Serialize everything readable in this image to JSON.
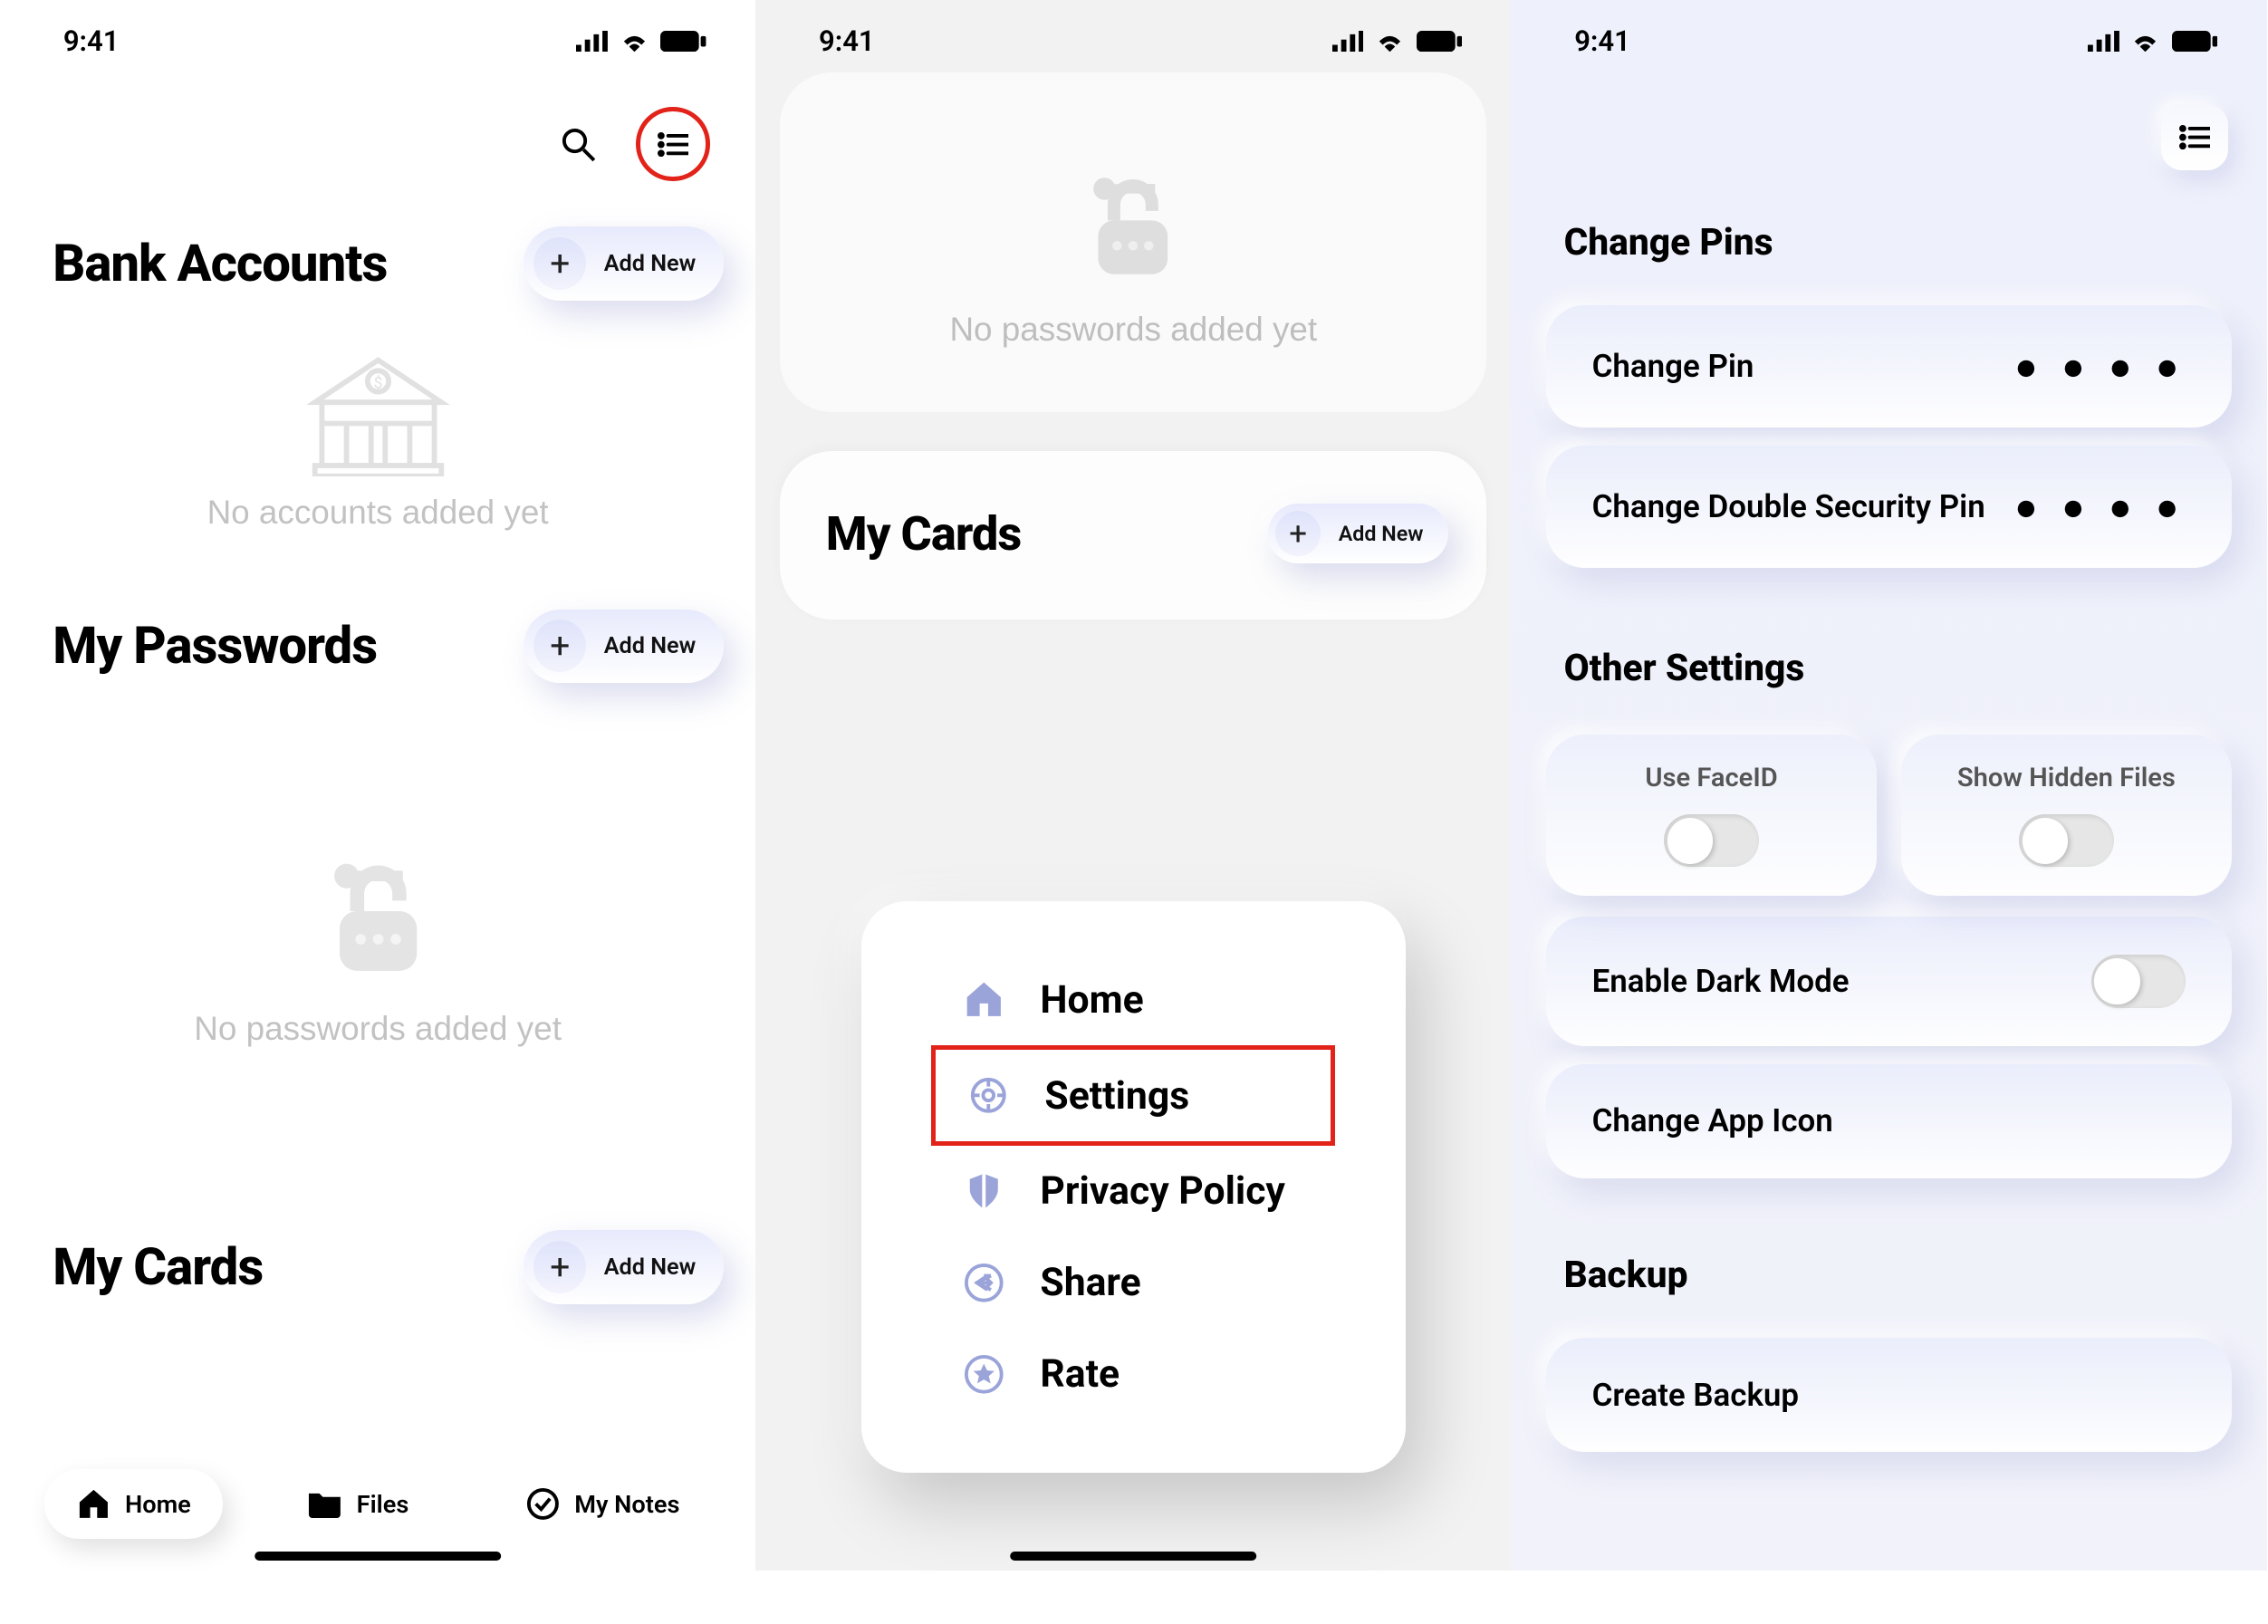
{
  "status": {
    "time": "9:41"
  },
  "screen1": {
    "sections": {
      "bank": {
        "title": "Bank Accounts",
        "add": "Add New",
        "empty": "No accounts added yet"
      },
      "passwords": {
        "title": "My Passwords",
        "add": "Add New",
        "empty": "No passwords added yet"
      },
      "cards": {
        "title": "My Cards",
        "add": "Add New"
      }
    },
    "tabs": {
      "home": "Home",
      "files": "Files",
      "notes": "My Notes"
    }
  },
  "screen2": {
    "passwords_empty": "No passwords added yet",
    "cards": {
      "title": "My Cards",
      "add": "Add New"
    },
    "menu": {
      "home": "Home",
      "settings": "Settings",
      "privacy": "Privacy Policy",
      "share": "Share",
      "rate": "Rate"
    }
  },
  "screen3": {
    "headings": {
      "pins": "Change Pins",
      "other": "Other Settings",
      "backup": "Backup"
    },
    "change_pin": "Change Pin",
    "change_double_pin": "Change Double Security Pin",
    "use_faceid": "Use FaceID",
    "show_hidden": "Show Hidden Files",
    "dark_mode": "Enable Dark Mode",
    "app_icon": "Change App Icon",
    "create_backup": "Create Backup",
    "dots": "● ● ● ●"
  }
}
